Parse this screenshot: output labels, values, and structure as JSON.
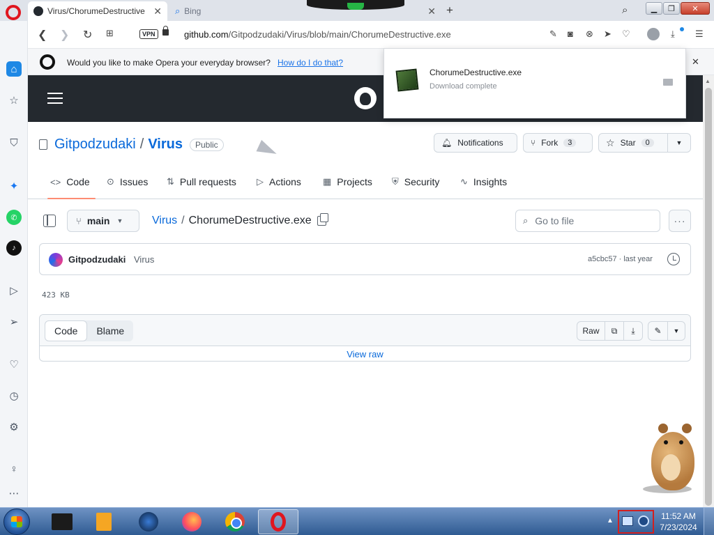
{
  "browser": {
    "tabs": [
      {
        "title": "Virus/ChorumeDestructive",
        "active": true,
        "favicon": "github-icon"
      },
      {
        "title": "Bing",
        "active": false,
        "favicon": "bing-icon"
      }
    ],
    "address": {
      "host": "github.com",
      "path": "/Gitpodzudaki/Virus/blob/main/ChorumeDestructive.exe",
      "vpn_label": "VPN"
    },
    "toolbar_icons": [
      "snapshot-icon",
      "camera-icon",
      "adblock-icon",
      "send-icon",
      "heart-icon",
      "profile-icon",
      "download-icon",
      "easy-setup-icon"
    ],
    "sidebar_icons": [
      "home-icon",
      "star-icon",
      "shopping-bag-icon",
      "messenger-icon",
      "whatsapp-icon",
      "tiktok-icon",
      "player-icon",
      "send-icon",
      "heart-icon",
      "history-icon",
      "settings-icon",
      "lightbulb-icon",
      "more-icon"
    ],
    "accent_color": "#e0161f"
  },
  "notice": {
    "text": "Would you like to make Opera your everyday browser?",
    "link": "How do I do that?"
  },
  "download_popup": {
    "filename": "ChorumeDestructive.exe",
    "status": "Download complete"
  },
  "repo": {
    "owner": "Gitpodzudaki",
    "name": "Virus",
    "visibility": "Public",
    "actions": {
      "notifications": "Notifications",
      "fork": "Fork",
      "fork_count": "3",
      "star": "Star",
      "star_count": "0"
    },
    "tabs": [
      {
        "label": "Code",
        "icon": "code-icon",
        "active": true
      },
      {
        "label": "Issues",
        "icon": "issues-icon"
      },
      {
        "label": "Pull requests",
        "icon": "pull-request-icon"
      },
      {
        "label": "Actions",
        "icon": "actions-icon"
      },
      {
        "label": "Projects",
        "icon": "projects-icon"
      },
      {
        "label": "Security",
        "icon": "shield-icon"
      },
      {
        "label": "Insights",
        "icon": "graph-icon"
      }
    ]
  },
  "file": {
    "branch": "main",
    "crumb_repo": "Virus",
    "crumb_sep": "/",
    "filename": "ChorumeDestructive.exe",
    "goto_placeholder": "Go to file",
    "commit": {
      "author": "Gitpodzudaki",
      "message": "Virus",
      "meta": "a5cbc57 · last year"
    },
    "size": "423 KB",
    "viewer": {
      "code_label": "Code",
      "blame_label": "Blame",
      "raw_label": "Raw",
      "view_raw": "View raw"
    }
  },
  "taskbar": {
    "time": "11:52 AM",
    "date": "7/23/2024"
  }
}
